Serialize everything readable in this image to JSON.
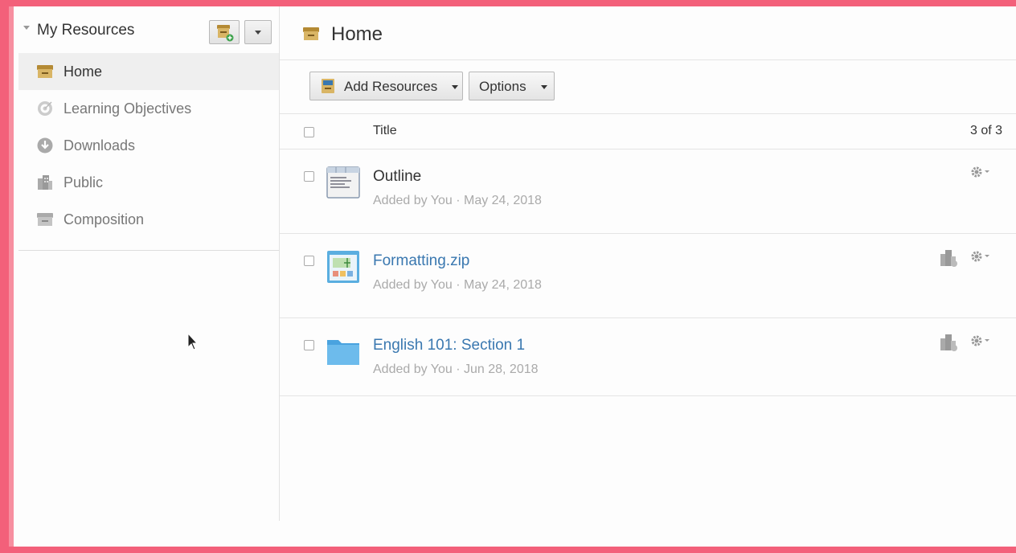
{
  "sidebar": {
    "title": "My Resources",
    "items": [
      {
        "label": "Home",
        "icon": "archive-box-icon",
        "active": true
      },
      {
        "label": "Learning Objectives",
        "icon": "target-icon",
        "active": false
      },
      {
        "label": "Downloads",
        "icon": "download-circle-icon",
        "active": false
      },
      {
        "label": "Public",
        "icon": "buildings-icon",
        "active": false
      },
      {
        "label": "Composition",
        "icon": "archive-box-icon",
        "active": false
      }
    ]
  },
  "main": {
    "title": "Home",
    "toolbar": {
      "add_resources": "Add Resources",
      "options": "Options"
    },
    "list": {
      "column_title": "Title",
      "count": "3 of 3",
      "rows": [
        {
          "title": "Outline",
          "meta": "Added by You · May 24, 2018",
          "icon": "document-icon",
          "link": false,
          "public": false
        },
        {
          "title": "Formatting.zip",
          "meta": "Added by You · May 24, 2018",
          "icon": "image-file-icon",
          "link": true,
          "public": true
        },
        {
          "title": "English 101: Section 1",
          "meta": "Added by You · Jun 28, 2018",
          "icon": "folder-icon",
          "link": true,
          "public": true
        }
      ]
    }
  },
  "colors": {
    "border": "#f3607a",
    "link": "#3a78b0",
    "box_brown": "#c8a04a"
  }
}
